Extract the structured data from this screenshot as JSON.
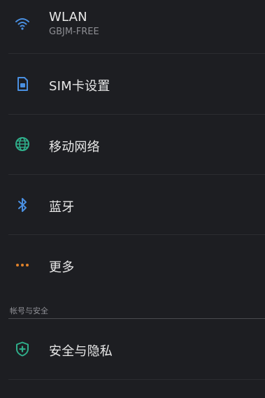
{
  "settings": {
    "wlan": {
      "title": "WLAN",
      "subtitle": "GBJM-FREE",
      "icon": "wifi-icon",
      "color": "#4a90e2"
    },
    "sim": {
      "title": "SIM卡设置",
      "icon": "sim-card-icon",
      "color": "#4a90e2"
    },
    "mobile_network": {
      "title": "移动网络",
      "icon": "globe-icon",
      "color": "#2fae8a"
    },
    "bluetooth": {
      "title": "蓝牙",
      "icon": "bluetooth-icon",
      "color": "#4a90e2"
    },
    "more": {
      "title": "更多",
      "icon": "more-dots-icon",
      "color": "#e0822a"
    }
  },
  "account_section": {
    "header": "帐号与安全",
    "security_privacy": {
      "title": "安全与隐私",
      "icon": "shield-icon",
      "color": "#2fae8a"
    }
  }
}
